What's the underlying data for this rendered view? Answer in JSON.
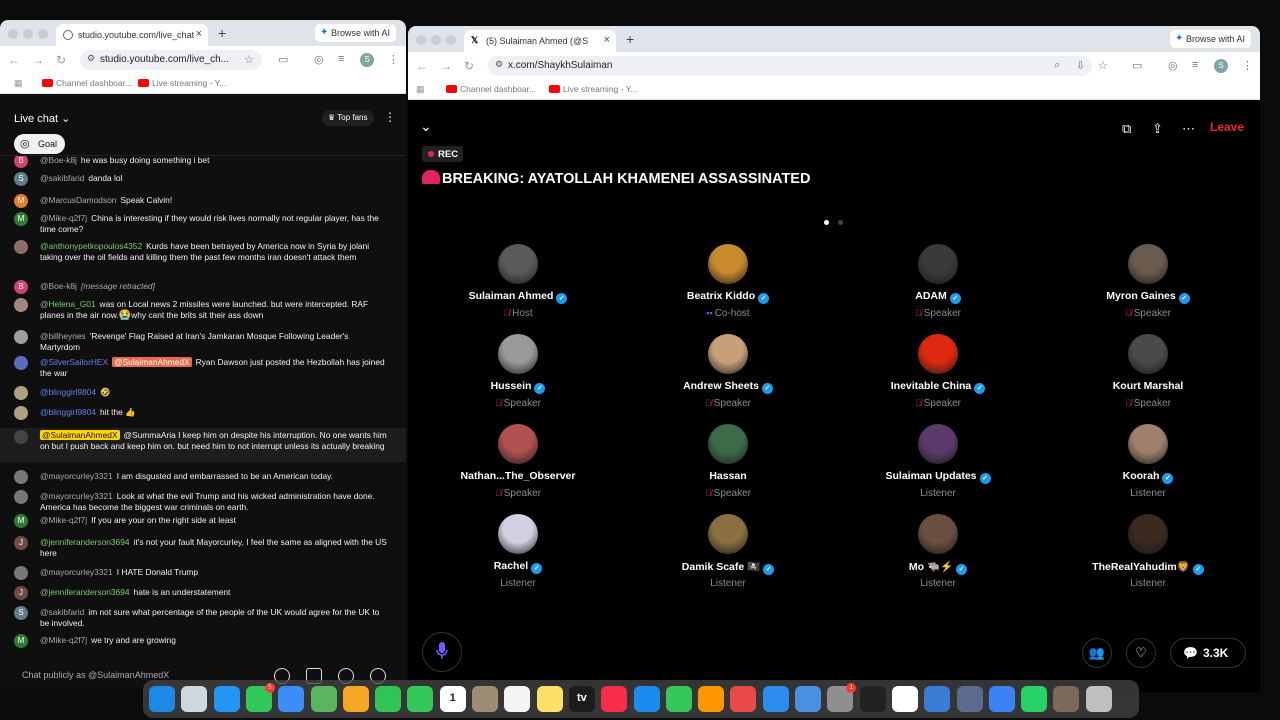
{
  "left_window": {
    "tab_title": "studio.youtube.com/live_chat",
    "browse_ai": "Browse with AI",
    "url": "studio.youtube.com/live_ch...",
    "profile_letter": "S",
    "bookmarks": [
      "Channel dashboar...",
      "Live streaming - Y..."
    ]
  },
  "chat": {
    "title": "Live chat",
    "top_fans": "Top fans",
    "goal": "Goal",
    "input_placeholder": "Chat publicly as @SulaimanAhmedX",
    "messages": [
      {
        "author": "@Boe-k8j",
        "text": "he was busy doing something i bet",
        "avatar": "B",
        "color": "#d5416f"
      },
      {
        "author": "@sakibfarid",
        "text": "danda lol",
        "avatar": "S",
        "color": "#607d8b"
      },
      {
        "author": "@MarcusDamodson",
        "text": "Speak Calvin!",
        "avatar": "M",
        "color": "#e67c22"
      },
      {
        "author": "@Mike-q2f7j",
        "text": "China is interesting if they would risk lives normally not regular player, has the time come?",
        "avatar": "M",
        "color": "#2e7d32"
      },
      {
        "author": "@anthonypetkopoulos4352",
        "text": "Kurds have been betrayed by America now in Syria by jolani taking over the oil fields and killing them the past few months iran doesn't attack them",
        "avatar": "",
        "color": "#8d6e63"
      },
      {
        "author": "@Boe-k8j",
        "text": "[message retracted]",
        "avatar": "B",
        "color": "#d5416f"
      },
      {
        "author": "@Helena_G01",
        "text": "was on Local news 2 missiles were launched. but were intercepted. RAF planes in the air now.",
        "text2": "why cant the brits sit their ass down",
        "avatar": "",
        "color": "#a1887f"
      },
      {
        "author": "@billheynes",
        "text": "'Revenge' Flag Raised at Iran's Jamkaran Mosque Following Leader's Martyrdom",
        "avatar": "",
        "color": "#9e9e9e"
      },
      {
        "author": "@SilverSailorHEX",
        "owner": "@SulaimanAhmedX",
        "text": "Ryan Dawson just posted the Hezbollah has joined the war",
        "avatar": "",
        "color": "#5c6bc0"
      },
      {
        "author": "@blinggirl9804",
        "text": "🤣",
        "avatar": "",
        "color": "#b0a080"
      },
      {
        "author": "@blinggirl9804",
        "text": "hit the 👍",
        "avatar": "",
        "color": "#b0a080"
      },
      {
        "author": "@SulaimanAhmedX",
        "text": "@SummaAria I keep him on despite his interruption. No one wants him on but I push back and keep him on. but need him to not interrupt unless its actually breaking",
        "avatar": "",
        "color": "#444"
      },
      {
        "author": "@mayorcurley3321",
        "text": "I am disgusted and embarrassed to be an American today.",
        "avatar": "",
        "color": "#777"
      },
      {
        "author": "@mayorcurley3321",
        "text": "Look at what the evil Trump and his wicked administration have done. America has become the biggest war criminals on earth.",
        "avatar": "",
        "color": "#777"
      },
      {
        "author": "@Mike-q2f7j",
        "text": "If you are your on the right side at least",
        "avatar": "M",
        "color": "#2e7d32"
      },
      {
        "author": "@jenniferanderson3694",
        "text": "it's not your fault Mayorcurley, I feel the same as aligned with the US here",
        "avatar": "J",
        "color": "#6d4c41"
      },
      {
        "author": "@mayorcurley3321",
        "text": "I HATE Donald Trump",
        "avatar": "",
        "color": "#777"
      },
      {
        "author": "@jenniferanderson3694",
        "text": "hate is an understatement",
        "avatar": "J",
        "color": "#6d4c41"
      },
      {
        "author": "@sakibfarid",
        "text": "im not sure what percentage of the people of the UK would agree for the UK to be involved.",
        "avatar": "S",
        "color": "#607d8b"
      },
      {
        "author": "@Mike-q2f7j",
        "text": "we try and are growing",
        "avatar": "M",
        "color": "#2e7d32"
      }
    ]
  },
  "right_window": {
    "tab_title": "(5) Sulaiman Ahmed (@S",
    "browse_ai": "Browse with AI",
    "url": "x.com/ShaykhSulaiman",
    "profile_letter": "S",
    "bookmarks": [
      "Channel dashboar...",
      "Live streaming - Y..."
    ]
  },
  "space": {
    "rec": "REC",
    "headline": "BREAKING: AYATOLLAH KHAMENEI ASSASSINATED",
    "leave": "Leave",
    "listener_count": "3.3K",
    "participants": [
      {
        "name": "Sulaiman Ahmed",
        "role": "Host",
        "verified": true,
        "muted": true,
        "color": "#5a5a5a"
      },
      {
        "name": "Beatrix Kiddo",
        "role": "Co-host",
        "verified": true,
        "cohost": true,
        "color": "#c98a2e"
      },
      {
        "name": "ADAM",
        "role": "Speaker",
        "verified": true,
        "muted": true,
        "color": "#3a3a3a"
      },
      {
        "name": "Myron Gaines",
        "role": "Speaker",
        "verified": true,
        "muted": true,
        "color": "#6b5a4e"
      },
      {
        "name": "Hussein",
        "role": "Speaker",
        "verified": true,
        "muted": true,
        "color": "#999"
      },
      {
        "name": "Andrew Sheets",
        "role": "Speaker",
        "verified": true,
        "muted": true,
        "color": "#c7a07a"
      },
      {
        "name": "Inevitable China",
        "role": "Speaker",
        "verified": true,
        "muted": true,
        "color": "#de2910"
      },
      {
        "name": "Kourt Marshal",
        "role": "Speaker",
        "verified": false,
        "muted": true,
        "color": "#4a4a4a"
      },
      {
        "name": "Nathan...The_Observer",
        "role": "Speaker",
        "verified": false,
        "muted": true,
        "color": "#b05050"
      },
      {
        "name": "Hassan",
        "role": "Speaker",
        "verified": false,
        "muted": true,
        "color": "#3d6b4a"
      },
      {
        "name": "Sulaiman Updates",
        "role": "Listener",
        "verified": true,
        "muted": false,
        "color": "#5a3a6a"
      },
      {
        "name": "Koorah",
        "role": "Listener",
        "verified": true,
        "muted": false,
        "color": "#a0806a"
      },
      {
        "name": "Rachel",
        "role": "Listener",
        "verified": true,
        "muted": false,
        "color": "#d0d0e0"
      },
      {
        "name": "Damik Scafe 🏴‍☠️",
        "role": "Listener",
        "verified": true,
        "muted": false,
        "color": "#8a7040"
      },
      {
        "name": "Mo 🐃⚡",
        "role": "Listener",
        "verified": true,
        "muted": false,
        "color": "#6a5040"
      },
      {
        "name": "TheRealYahudim🦁",
        "role": "Listener",
        "verified": true,
        "muted": false,
        "color": "#3a2a20"
      }
    ]
  },
  "dock": {
    "apps": [
      {
        "name": "finder-icon",
        "color": "#1e88e5"
      },
      {
        "name": "launchpad-icon",
        "color": "#cfd8dc"
      },
      {
        "name": "safari-icon",
        "color": "#2196f3"
      },
      {
        "name": "messages-icon",
        "color": "#34c759",
        "badge": "5"
      },
      {
        "name": "mail-icon",
        "color": "#3b8ef5"
      },
      {
        "name": "maps-icon",
        "color": "#5ab55e"
      },
      {
        "name": "photos-icon",
        "color": "#f5a623"
      },
      {
        "name": "facetime-icon",
        "color": "#30c552"
      },
      {
        "name": "phone-icon",
        "color": "#34c759"
      },
      {
        "name": "calendar-icon",
        "color": "#ffffff",
        "label": "1"
      },
      {
        "name": "contacts-icon",
        "color": "#9e8c76"
      },
      {
        "name": "reminders-icon",
        "color": "#f5f5f5"
      },
      {
        "name": "notes-icon",
        "color": "#ffe066"
      },
      {
        "name": "tv-icon",
        "color": "#1c1c1e",
        "label": "tv"
      },
      {
        "name": "music-icon",
        "color": "#fa2d48"
      },
      {
        "name": "keynote-icon",
        "color": "#1a8cf0"
      },
      {
        "name": "numbers-icon",
        "color": "#34c759"
      },
      {
        "name": "pages-icon",
        "color": "#ff9500"
      },
      {
        "name": "rocket-icon",
        "color": "#e84a4a"
      },
      {
        "name": "app-store-icon",
        "color": "#2d8cf0"
      },
      {
        "name": "preview-icon",
        "color": "#4a90e2"
      },
      {
        "name": "system-settings-icon",
        "color": "#8e8e93",
        "badge": "1"
      },
      {
        "name": "activity-icon",
        "color": "#222222"
      },
      {
        "name": "chrome-icon",
        "color": "#ffffff"
      },
      {
        "name": "screen-share-icon",
        "color": "#3a7bd5"
      },
      {
        "name": "finder-2-icon",
        "color": "#5b6b8f"
      },
      {
        "name": "quicktime-icon",
        "color": "#3b82f6"
      },
      {
        "name": "whatsapp-icon",
        "color": "#25d366"
      },
      {
        "name": "photo-stack-icon",
        "color": "#7a6a5a"
      },
      {
        "name": "trash-icon",
        "color": "#c0c0c0"
      }
    ]
  }
}
